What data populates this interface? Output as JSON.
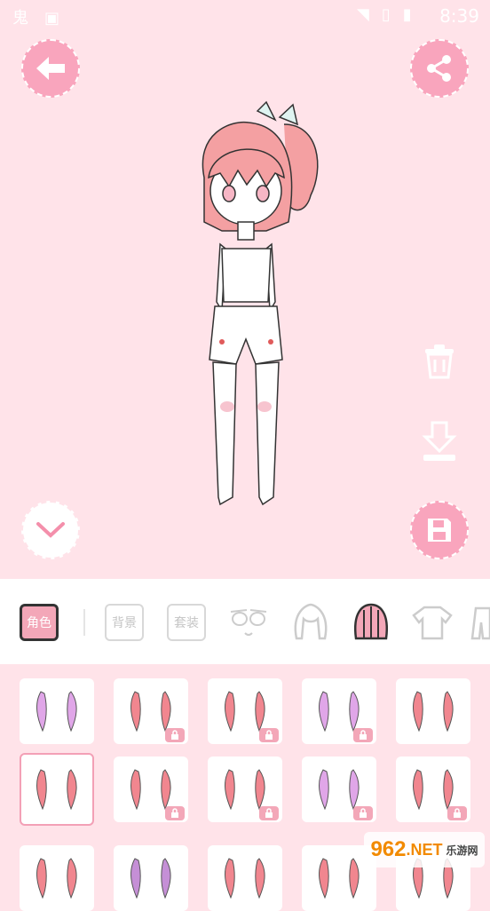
{
  "status_bar": {
    "time": "8:39",
    "left_icons": [
      "app-icon",
      "image-icon"
    ],
    "right_icons": [
      "wifi-icon",
      "no-sim-icon",
      "battery-charging-icon"
    ]
  },
  "header": {
    "back_icon": "arrow-left-icon",
    "share_icon": "share-icon"
  },
  "side_actions": {
    "delete_icon": "trash-icon",
    "download_icon": "download-icon",
    "save_icon": "floppy-disk-icon",
    "collapse_icon": "chevron-down-icon"
  },
  "tabs": [
    {
      "label": "角色",
      "active": true
    },
    {
      "label": "背景",
      "active": false
    },
    {
      "label": "套装",
      "active": false
    },
    {
      "label": "",
      "icon": "face-icon"
    },
    {
      "label": "",
      "icon": "hair-icon"
    },
    {
      "label": "",
      "icon": "back-hair-icon",
      "active_style": true
    },
    {
      "label": "",
      "icon": "shirt-icon"
    },
    {
      "label": "",
      "icon": "pants-icon"
    }
  ],
  "items": [
    {
      "color": "#e0a6e8",
      "locked": false
    },
    {
      "color": "#f1868f",
      "locked": true
    },
    {
      "color": "#f1868f",
      "locked": true
    },
    {
      "color": "#e0a6e8",
      "locked": true
    },
    {
      "color": "#f1868f",
      "locked": false
    },
    {
      "color": "#f1868f",
      "locked": false,
      "selected": true
    },
    {
      "color": "#f1868f",
      "locked": true
    },
    {
      "color": "#f1868f",
      "locked": true
    },
    {
      "color": "#e0a6e8",
      "locked": true
    },
    {
      "color": "#f1868f",
      "locked": true
    },
    {
      "color": "#f1868f",
      "locked": false
    },
    {
      "color": "#c58fd6",
      "locked": false
    },
    {
      "color": "#f1868f",
      "locked": false
    },
    {
      "color": "#f1868f",
      "locked": false
    },
    {
      "color": "#f1868f",
      "locked": false
    }
  ],
  "watermark": {
    "text": "962",
    "suffix": ".NET",
    "sub": "乐游网"
  },
  "colors": {
    "accent": "#f9a5bd",
    "background": "#ffe3e9"
  }
}
